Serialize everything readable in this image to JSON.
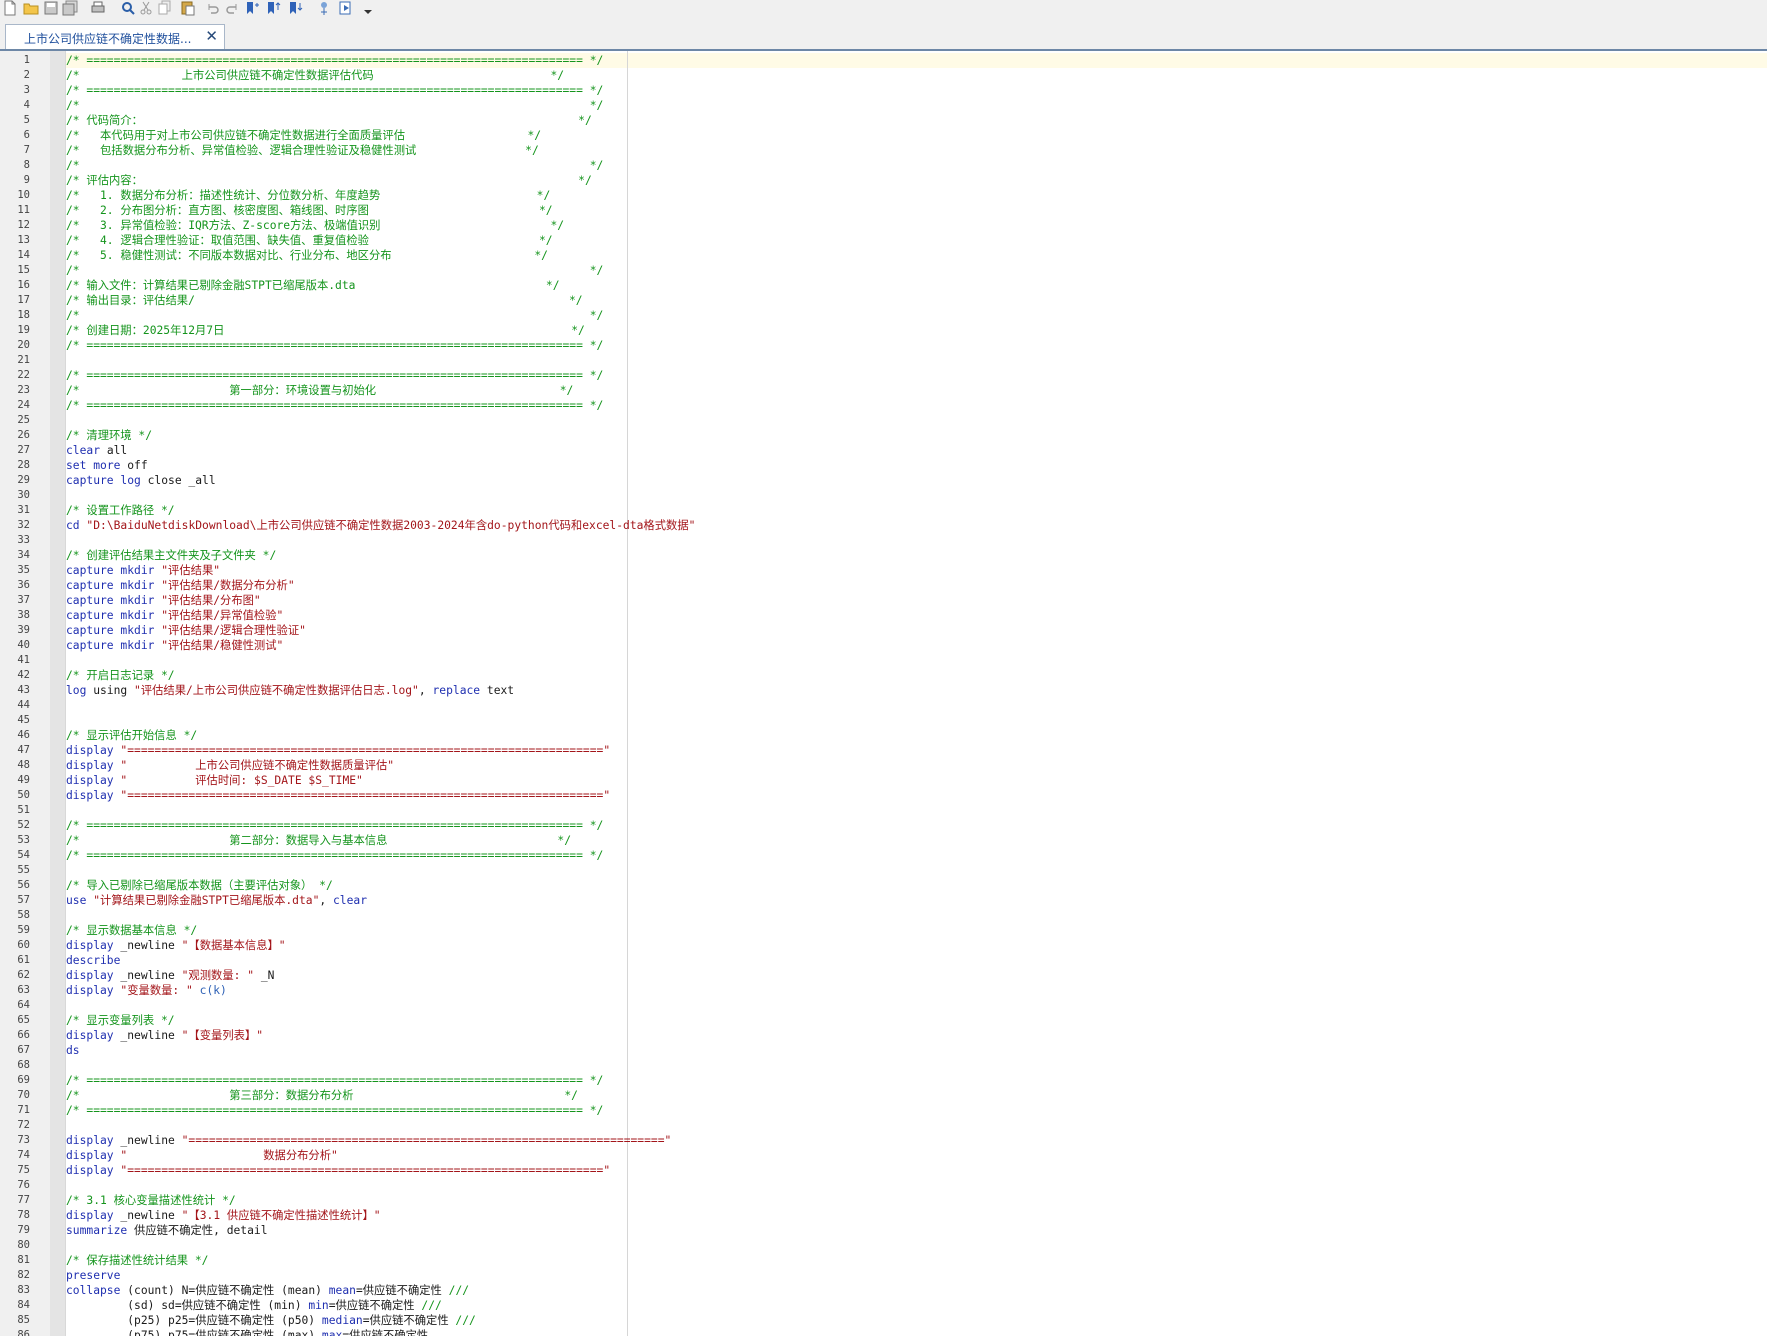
{
  "toolbar": {
    "buttons": [
      "new-file-icon",
      "open-folder-icon",
      "save-icon",
      "save-all-icon",
      "print-icon",
      "find-icon",
      "cut-icon",
      "copy-icon",
      "paste-icon",
      "undo-icon",
      "redo-icon",
      "bookmark-toggle-icon",
      "bookmark-previous-icon",
      "bookmark-next-icon",
      "run-icon",
      "execute-selection-icon",
      "dropdown-arrow-icon"
    ]
  },
  "tab": {
    "label": "上市公司供应链不确定性数据...",
    "close": "✕"
  },
  "editor": {
    "lines": [
      [
        [
          "cm",
          "/* ========================================================================= */"
        ]
      ],
      [
        [
          "cm",
          "/*               上市公司供应链不确定性数据评估代码                          */"
        ]
      ],
      [
        [
          "cm",
          "/* ========================================================================= */"
        ]
      ],
      [
        [
          "cm",
          "/*                                                                           */"
        ]
      ],
      [
        [
          "cm",
          "/* 代码简介：                                                                */"
        ]
      ],
      [
        [
          "cm",
          "/*   本代码用于对上市公司供应链不确定性数据进行全面质量评估                  */"
        ]
      ],
      [
        [
          "cm",
          "/*   包括数据分布分析、异常值检验、逻辑合理性验证及稳健性测试                */"
        ]
      ],
      [
        [
          "cm",
          "/*                                                                           */"
        ]
      ],
      [
        [
          "cm",
          "/* 评估内容：                                                                */"
        ]
      ],
      [
        [
          "cm",
          "/*   1. 数据分布分析：描述性统计、分位数分析、年度趋势                       */"
        ]
      ],
      [
        [
          "cm",
          "/*   2. 分布图分析：直方图、核密度图、箱线图、时序图                         */"
        ]
      ],
      [
        [
          "cm",
          "/*   3. 异常值检验：IQR方法、Z-score方法、极端值识别                         */"
        ]
      ],
      [
        [
          "cm",
          "/*   4. 逻辑合理性验证：取值范围、缺失值、重复值检验                         */"
        ]
      ],
      [
        [
          "cm",
          "/*   5. 稳健性测试：不同版本数据对比、行业分布、地区分布                     */"
        ]
      ],
      [
        [
          "cm",
          "/*                                                                           */"
        ]
      ],
      [
        [
          "cm",
          "/* 输入文件：计算结果已剔除金融STPT已缩尾版本.dta                            */"
        ]
      ],
      [
        [
          "cm",
          "/* 输出目录：评估结果/                                                       */"
        ]
      ],
      [
        [
          "cm",
          "/*                                                                           */"
        ]
      ],
      [
        [
          "cm",
          "/* 创建日期：2025年12月7日                                                   */"
        ]
      ],
      [
        [
          "cm",
          "/* ========================================================================= */"
        ]
      ],
      [],
      [
        [
          "cm",
          "/* ========================================================================= */"
        ]
      ],
      [
        [
          "cm",
          "/*                      第一部分：环境设置与初始化                           */"
        ]
      ],
      [
        [
          "cm",
          "/* ========================================================================= */"
        ]
      ],
      [],
      [
        [
          "cm",
          "/* 清理环境 */"
        ]
      ],
      [
        [
          "kw",
          "clear"
        ],
        [
          "id",
          " all"
        ]
      ],
      [
        [
          "kw",
          "set"
        ],
        [
          "id",
          " "
        ],
        [
          "kw",
          "more"
        ],
        [
          "id",
          " off"
        ]
      ],
      [
        [
          "kw",
          "capture"
        ],
        [
          "id",
          " "
        ],
        [
          "kw",
          "log"
        ],
        [
          "id",
          " close _all"
        ]
      ],
      [],
      [
        [
          "cm",
          "/* 设置工作路径 */"
        ]
      ],
      [
        [
          "kw",
          "cd"
        ],
        [
          "id",
          " "
        ],
        [
          "st",
          "\"D:\\BaiduNetdiskDownload\\上市公司供应链不确定性数据2003-2024年含do-python代码和excel-dta格式数据\""
        ]
      ],
      [],
      [
        [
          "cm",
          "/* 创建评估结果主文件夹及子文件夹 */"
        ]
      ],
      [
        [
          "kw",
          "capture"
        ],
        [
          "id",
          " "
        ],
        [
          "kw",
          "mkdir"
        ],
        [
          "id",
          " "
        ],
        [
          "st",
          "\"评估结果\""
        ]
      ],
      [
        [
          "kw",
          "capture"
        ],
        [
          "id",
          " "
        ],
        [
          "kw",
          "mkdir"
        ],
        [
          "id",
          " "
        ],
        [
          "st",
          "\"评估结果/数据分布分析\""
        ]
      ],
      [
        [
          "kw",
          "capture"
        ],
        [
          "id",
          " "
        ],
        [
          "kw",
          "mkdir"
        ],
        [
          "id",
          " "
        ],
        [
          "st",
          "\"评估结果/分布图\""
        ]
      ],
      [
        [
          "kw",
          "capture"
        ],
        [
          "id",
          " "
        ],
        [
          "kw",
          "mkdir"
        ],
        [
          "id",
          " "
        ],
        [
          "st",
          "\"评估结果/异常值检验\""
        ]
      ],
      [
        [
          "kw",
          "capture"
        ],
        [
          "id",
          " "
        ],
        [
          "kw",
          "mkdir"
        ],
        [
          "id",
          " "
        ],
        [
          "st",
          "\"评估结果/逻辑合理性验证\""
        ]
      ],
      [
        [
          "kw",
          "capture"
        ],
        [
          "id",
          " "
        ],
        [
          "kw",
          "mkdir"
        ],
        [
          "id",
          " "
        ],
        [
          "st",
          "\"评估结果/稳健性测试\""
        ]
      ],
      [],
      [
        [
          "cm",
          "/* 开启日志记录 */"
        ]
      ],
      [
        [
          "kw",
          "log"
        ],
        [
          "id",
          " using "
        ],
        [
          "st",
          "\"评估结果/上市公司供应链不确定性数据评估日志.log\""
        ],
        [
          "id",
          ", "
        ],
        [
          "kw",
          "replace"
        ],
        [
          "id",
          " text"
        ]
      ],
      [],
      [],
      [
        [
          "cm",
          "/* 显示评估开始信息 */"
        ]
      ],
      [
        [
          "kw",
          "display"
        ],
        [
          "id",
          " "
        ],
        [
          "st",
          "\"======================================================================\""
        ]
      ],
      [
        [
          "kw",
          "display"
        ],
        [
          "id",
          " "
        ],
        [
          "st",
          "\"          上市公司供应链不确定性数据质量评估\""
        ]
      ],
      [
        [
          "kw",
          "display"
        ],
        [
          "id",
          " "
        ],
        [
          "st",
          "\"          评估时间: $S_DATE $S_TIME\""
        ]
      ],
      [
        [
          "kw",
          "display"
        ],
        [
          "id",
          " "
        ],
        [
          "st",
          "\"======================================================================\""
        ]
      ],
      [],
      [
        [
          "cm",
          "/* ========================================================================= */"
        ]
      ],
      [
        [
          "cm",
          "/*                      第二部分：数据导入与基本信息                         */"
        ]
      ],
      [
        [
          "cm",
          "/* ========================================================================= */"
        ]
      ],
      [],
      [
        [
          "cm",
          "/* 导入已剔除已缩尾版本数据（主要评估对象） */"
        ]
      ],
      [
        [
          "kw",
          "use"
        ],
        [
          "id",
          " "
        ],
        [
          "st",
          "\"计算结果已剔除金融STPT已缩尾版本.dta\""
        ],
        [
          "id",
          ", "
        ],
        [
          "kw",
          "clear"
        ]
      ],
      [],
      [
        [
          "cm",
          "/* 显示数据基本信息 */"
        ]
      ],
      [
        [
          "kw",
          "display"
        ],
        [
          "id",
          " _newline "
        ],
        [
          "st",
          "\"【数据基本信息】\""
        ]
      ],
      [
        [
          "kw",
          "describe"
        ]
      ],
      [
        [
          "kw",
          "display"
        ],
        [
          "id",
          " _newline "
        ],
        [
          "st",
          "\"观测数量: \""
        ],
        [
          "id",
          " _N"
        ]
      ],
      [
        [
          "kw",
          "display"
        ],
        [
          "id",
          " "
        ],
        [
          "st",
          "\"变量数量: \""
        ],
        [
          "id",
          " "
        ],
        [
          "mc",
          "c(k)"
        ]
      ],
      [],
      [
        [
          "cm",
          "/* 显示变量列表 */"
        ]
      ],
      [
        [
          "kw",
          "display"
        ],
        [
          "id",
          " _newline "
        ],
        [
          "st",
          "\"【变量列表】\""
        ]
      ],
      [
        [
          "kw",
          "ds"
        ]
      ],
      [],
      [
        [
          "cm",
          "/* ========================================================================= */"
        ]
      ],
      [
        [
          "cm",
          "/*                      第三部分：数据分布分析                               */"
        ]
      ],
      [
        [
          "cm",
          "/* ========================================================================= */"
        ]
      ],
      [],
      [
        [
          "kw",
          "display"
        ],
        [
          "id",
          " _newline "
        ],
        [
          "st",
          "\"======================================================================\""
        ]
      ],
      [
        [
          "kw",
          "display"
        ],
        [
          "id",
          " "
        ],
        [
          "st",
          "\"                    数据分布分析\""
        ]
      ],
      [
        [
          "kw",
          "display"
        ],
        [
          "id",
          " "
        ],
        [
          "st",
          "\"======================================================================\""
        ]
      ],
      [],
      [
        [
          "cm",
          "/* 3.1 核心变量描述性统计 */"
        ]
      ],
      [
        [
          "kw",
          "display"
        ],
        [
          "id",
          " _newline "
        ],
        [
          "st",
          "\"【3.1 供应链不确定性描述性统计】\""
        ]
      ],
      [
        [
          "kw",
          "summarize"
        ],
        [
          "id",
          " 供应链不确定性, detail"
        ]
      ],
      [],
      [
        [
          "cm",
          "/* 保存描述性统计结果 */"
        ]
      ],
      [
        [
          "kw",
          "preserve"
        ]
      ],
      [
        [
          "kw",
          "collapse"
        ],
        [
          "id",
          " (count) N=供应链不确定性 (mean) "
        ],
        [
          "kw",
          "mean"
        ],
        [
          "id",
          "=供应链不确定性 "
        ],
        [
          "cm",
          "///"
        ]
      ],
      [
        [
          "id",
          "         (sd) sd=供应链不确定性 (min) "
        ],
        [
          "kw",
          "min"
        ],
        [
          "id",
          "=供应链不确定性 "
        ],
        [
          "cm",
          "///"
        ]
      ],
      [
        [
          "id",
          "         (p25) p25=供应链不确定性 (p50) "
        ],
        [
          "kw",
          "median"
        ],
        [
          "id",
          "=供应链不确定性 "
        ],
        [
          "cm",
          "///"
        ]
      ],
      [
        [
          "id",
          "         (p75) p75=供应链不确定性 (max) "
        ],
        [
          "kw",
          "max"
        ],
        [
          "id",
          "=供应链不确定性"
        ]
      ]
    ]
  }
}
